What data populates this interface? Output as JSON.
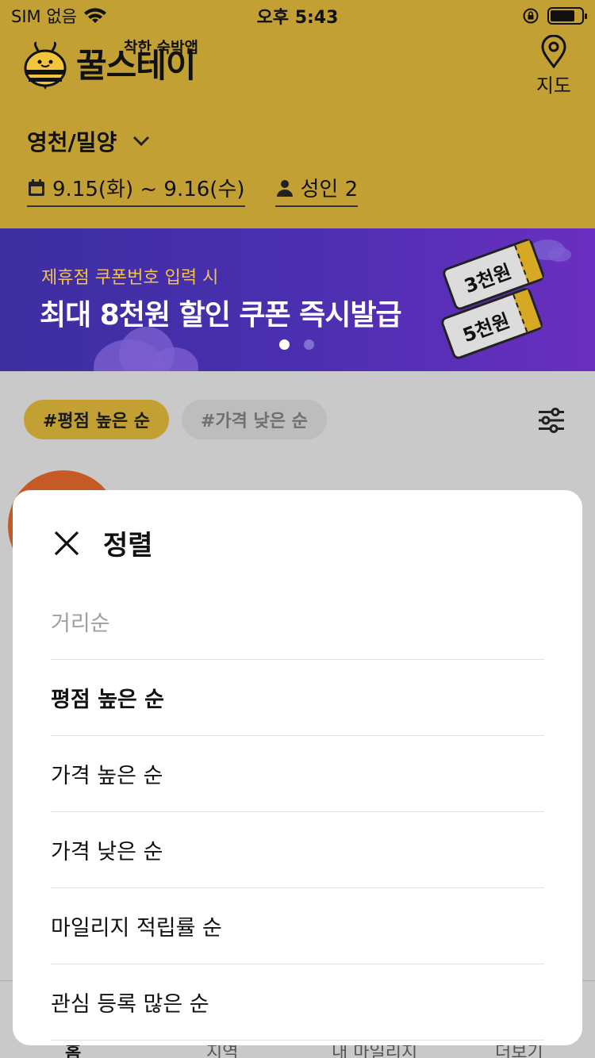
{
  "status_bar": {
    "carrier": "SIM 없음",
    "time": "오후 5:43"
  },
  "header": {
    "logo_tagline": "착한 숙박앱",
    "logo_name": "꿀스테이",
    "map_label": "지도",
    "region": "영천/밀양",
    "dates": "9.15(화) ~ 9.16(수)",
    "guests": "성인 2"
  },
  "banner": {
    "subtitle": "제휴점 쿠폰번호 입력 시",
    "title": "최대 8천원 할인 쿠폰  즉시발급",
    "ticket_1": "3천원",
    "ticket_2": "5천원",
    "page_count": 2,
    "active_page": 1
  },
  "sort_tags": [
    {
      "label": "#평점 높은 순",
      "active": true
    },
    {
      "label": "#가격 낮은 순",
      "active": false
    }
  ],
  "tab_bar": {
    "items": [
      "홈",
      "지역",
      "내 마일리지",
      "더보기"
    ]
  },
  "sort_sheet": {
    "title": "정렬",
    "options": [
      {
        "label": "거리순",
        "state": "disabled"
      },
      {
        "label": "평점 높은 순",
        "state": "selected"
      },
      {
        "label": "가격 높은 순",
        "state": "normal"
      },
      {
        "label": "가격 낮은 순",
        "state": "normal"
      },
      {
        "label": "마일리지 적립률 순",
        "state": "normal"
      },
      {
        "label": "관심 등록 많은 순",
        "state": "normal"
      }
    ]
  },
  "colors": {
    "brand_yellow": "#c3a033",
    "banner_purple": "#4a2fb0",
    "banner_accent": "#f2c14e"
  }
}
